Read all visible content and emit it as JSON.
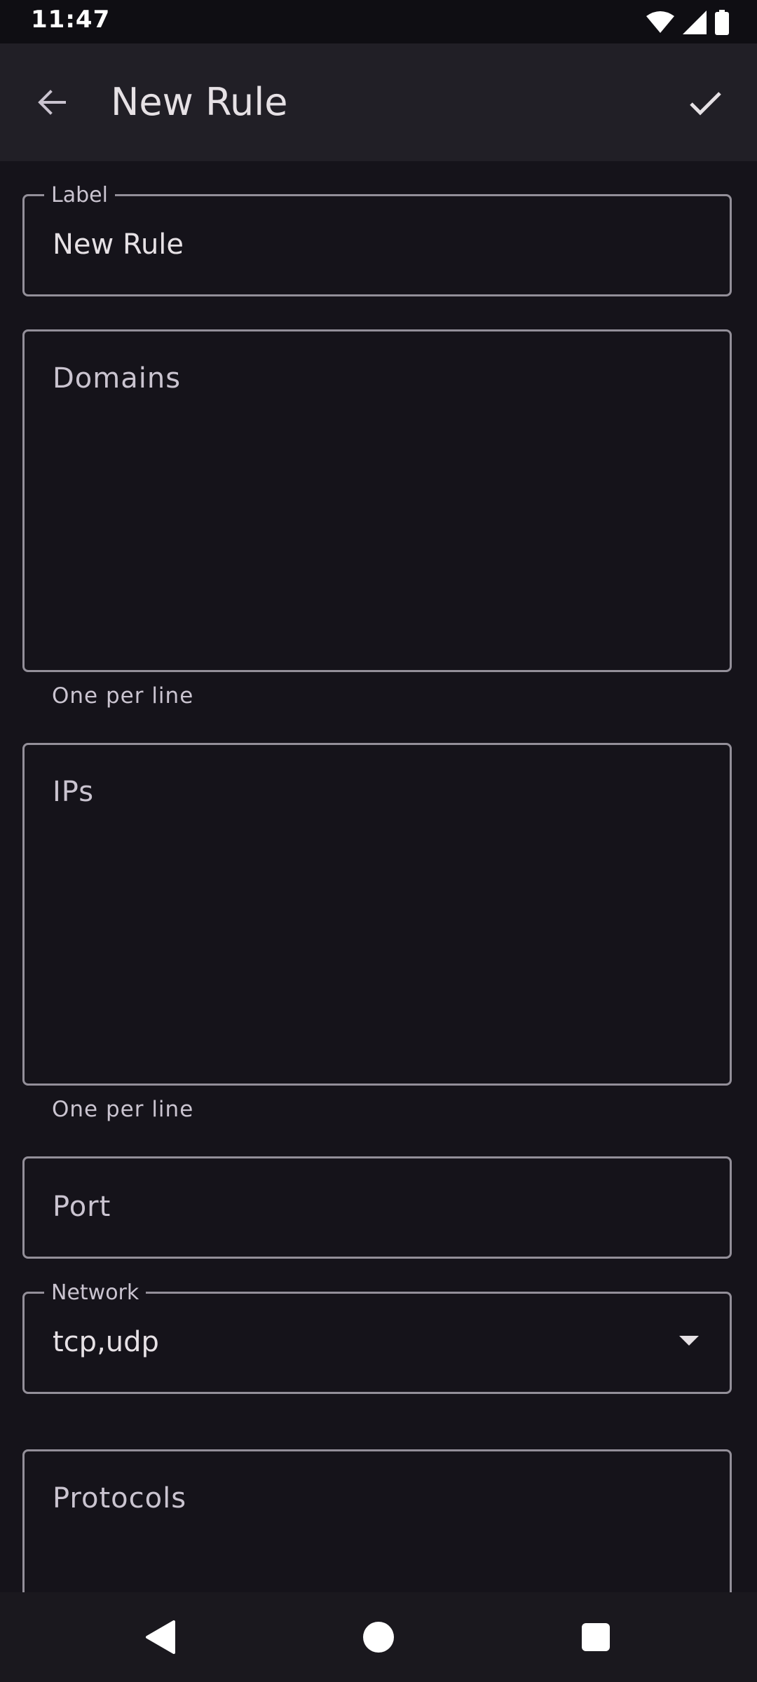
{
  "status_bar": {
    "time": "11:47"
  },
  "app_bar": {
    "title": "New Rule"
  },
  "form": {
    "label": {
      "label": "Label",
      "value": "New Rule"
    },
    "domains": {
      "placeholder": "Domains",
      "supporting": "One per line"
    },
    "ips": {
      "placeholder": "IPs",
      "supporting": "One per line"
    },
    "port": {
      "placeholder": "Port"
    },
    "network": {
      "label": "Network",
      "value": "tcp,udp"
    },
    "protocols": {
      "placeholder": "Protocols"
    }
  },
  "colors": {
    "background": "#15131a",
    "app_bar": "#211f26",
    "outline": "#938f99",
    "text": "#e6e1e5"
  },
  "icons": [
    "wifi-icon",
    "signal-icon",
    "battery-icon",
    "back-arrow-icon",
    "check-icon",
    "nav-back-icon",
    "nav-home-icon",
    "nav-recents-icon"
  ]
}
